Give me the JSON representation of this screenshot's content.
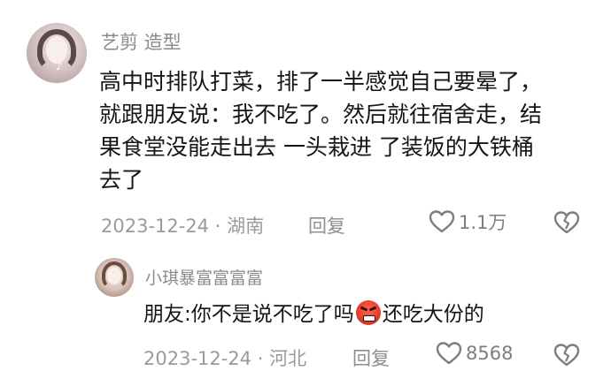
{
  "comments": [
    {
      "username": "艺剪 造型",
      "lines": [
        "高中时排队打菜，排了一半感觉自己要晕了，",
        "就跟朋友说：我不吃了。然后就往宿舍走，结",
        "果食堂没能走出去 一头栽进 了装饭的大铁桶",
        "去了"
      ],
      "date": "2023-12-24",
      "separator": "·",
      "location": "湖南",
      "reply_label": "回复",
      "likes": "1.1万"
    },
    {
      "username": "小琪暴富富富富",
      "text_before": "朋友:你不是说不吃了吗",
      "emoji": "angry-face-emoji",
      "text_after": "还吃大份的",
      "date": "2023-12-24",
      "separator": "·",
      "location": "河北",
      "reply_label": "回复",
      "likes": "8568"
    }
  ],
  "colors": {
    "text": "#151515",
    "meta": "#9a9a9f",
    "icon": "#7d7d82",
    "background": "#ffffff"
  }
}
